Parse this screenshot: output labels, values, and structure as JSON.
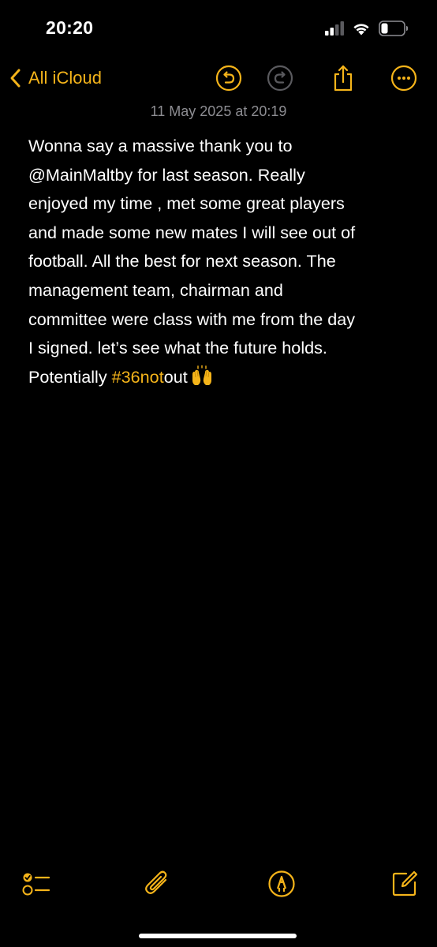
{
  "status_bar": {
    "time": "20:20",
    "signal_icon": "cellular-signal-icon",
    "wifi_icon": "wifi-icon",
    "battery_icon": "battery-icon"
  },
  "nav": {
    "back_label": "All iCloud",
    "back_icon": "chevron-left-icon",
    "undo_icon": "undo-icon",
    "redo_icon": "redo-icon",
    "share_icon": "share-icon",
    "more_icon": "more-icon"
  },
  "note": {
    "date": "11 May 2025 at 20:19",
    "lines": [
      "Wonna say a massive thank you to",
      "@MainMaltby for last season. Really",
      "enjoyed my time , met some great players",
      "and made some new mates I will see out of",
      "football. All the best for next season. The",
      "management team, chairman and",
      "committee were class with me from the day",
      "I signed.  let’s see what the future holds."
    ],
    "last_line_prefix": "Potentially ",
    "hashtag": "#36not",
    "last_line_suffix": "out",
    "emoji": "🙌"
  },
  "toolbar": {
    "checklist_icon": "checklist-icon",
    "attachment_icon": "paperclip-icon",
    "markup_icon": "markup-pen-icon",
    "compose_icon": "compose-icon"
  },
  "colors": {
    "accent": "#f5b41a",
    "background": "#000000",
    "text": "#ffffff",
    "secondary_text": "#8d8d92"
  }
}
